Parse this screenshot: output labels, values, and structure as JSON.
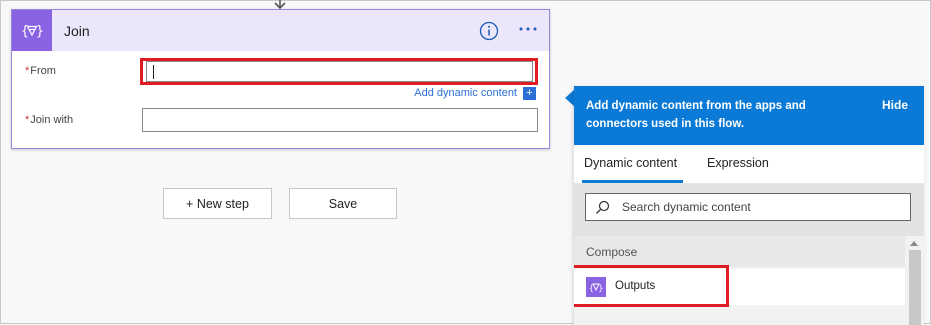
{
  "card": {
    "title": "Join",
    "from_label": "From",
    "join_with_label": "Join with",
    "required_mark": "*",
    "add_dynamic_content": "Add dynamic content",
    "add_dynamic_plus": "+",
    "from_value": "",
    "join_with_value": ""
  },
  "actions": {
    "new_step": "+ New step",
    "save": "Save"
  },
  "dynamic_panel": {
    "header_text": "Add dynamic content from the apps and connectors used in this flow.",
    "hide": "Hide",
    "tabs": [
      {
        "label": "Dynamic content",
        "selected": true
      },
      {
        "label": "Expression",
        "selected": false
      }
    ],
    "search_placeholder": "Search dynamic content",
    "section": "Compose",
    "items": [
      {
        "label": "Outputs",
        "icon": "variable-icon"
      }
    ]
  },
  "colors": {
    "accent_purple": "#8a63e2",
    "header_purple_bg": "#ece6fb",
    "panel_blue": "#0b7ad6",
    "highlight_red": "#e01b24",
    "link_blue": "#2b6fd6"
  }
}
